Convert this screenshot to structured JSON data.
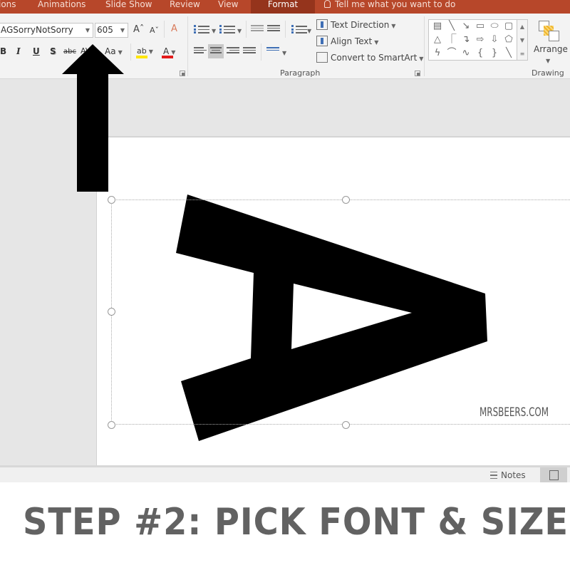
{
  "ribbon_tabs": [
    {
      "label": "ions",
      "active": false
    },
    {
      "label": "Animations",
      "active": false
    },
    {
      "label": "Slide Show",
      "active": false
    },
    {
      "label": "Review",
      "active": false
    },
    {
      "label": "View",
      "active": false
    },
    {
      "label": "Format",
      "active": true
    }
  ],
  "tell_me": {
    "placeholder": "Tell me what you want to do"
  },
  "font_group": {
    "font_name": "AGSorryNotSorry",
    "font_size": "605",
    "grow_font": "Aˆ",
    "shrink_font": "Aˇ",
    "bold": "B",
    "italic": "I",
    "underline": "U",
    "shadow": "S",
    "strikethrough": "abc",
    "char_spacing": "AV",
    "change_case": "Aa",
    "highlight": "ab",
    "font_color": "A",
    "highlight_color": "#ffe600",
    "font_color_value": "#e31b1b"
  },
  "paragraph_group": {
    "label": "Paragraph",
    "text_direction": "Text Direction",
    "align_text": "Align Text",
    "convert_smartart": "Convert to SmartArt"
  },
  "drawing_group": {
    "label": "Drawing",
    "arrange": "Arrange",
    "shapes": [
      "text-box",
      "line",
      "arrow-line",
      "rectangle",
      "oval",
      "rounded-rectangle",
      "triangle",
      "elbow-connector",
      "elbow-arrow-connector",
      "right-arrow",
      "down-arrow",
      "snip-shape",
      "freeform",
      "arc",
      "curve",
      "left-brace",
      "right-brace",
      "line-2"
    ]
  },
  "slide": {
    "big_letter": "A",
    "watermark": "MRSBEERS.COM"
  },
  "status_bar": {
    "notes_label": "Notes"
  },
  "caption": "STEP #2: PICK FONT & SIZE",
  "colors": {
    "tab_bar": "#b7472a",
    "active_tab": "#95341c",
    "caption": "#626262"
  }
}
